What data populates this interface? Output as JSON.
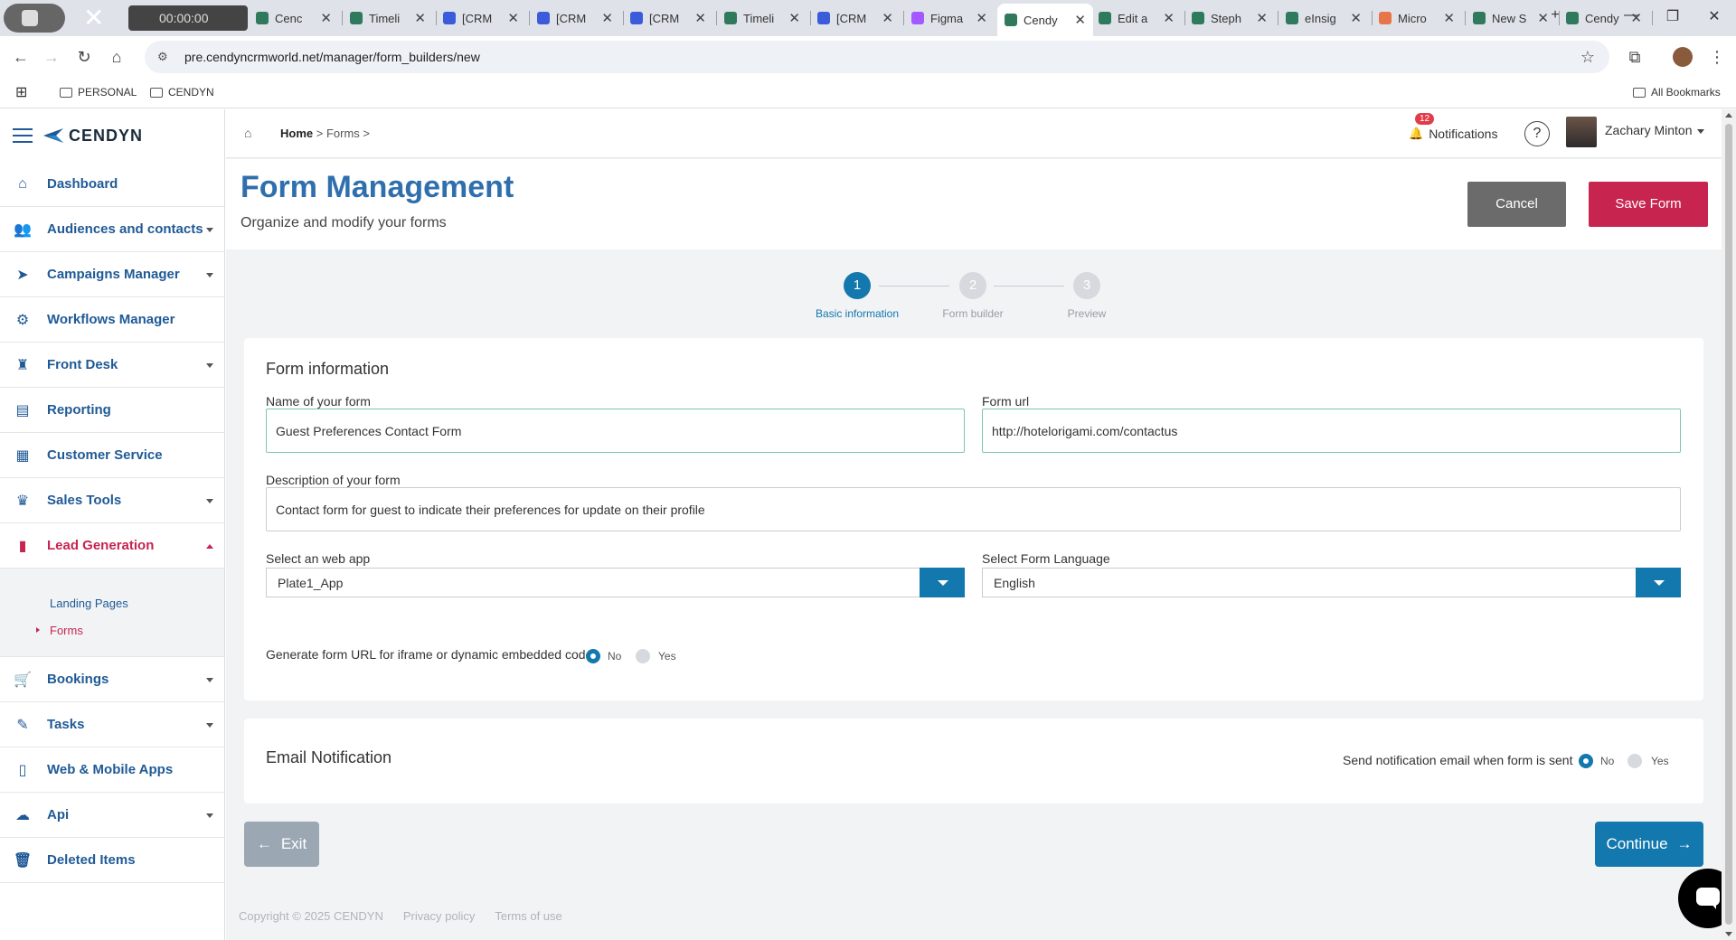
{
  "browser": {
    "tabs": [
      {
        "title": "Cenc",
        "icon": "cendyn-icon",
        "color": "#2f7a5c"
      },
      {
        "title": "Timeli",
        "icon": "cendyn-icon",
        "color": "#2f7a5c"
      },
      {
        "title": "[CRM",
        "icon": "jira-icon",
        "color": "#3b5bdb"
      },
      {
        "title": "[CRM",
        "icon": "jira-icon",
        "color": "#3b5bdb"
      },
      {
        "title": "[CRM",
        "icon": "jira-icon",
        "color": "#3b5bdb"
      },
      {
        "title": "Timeli",
        "icon": "cendyn-icon",
        "color": "#2f7a5c"
      },
      {
        "title": "[CRM",
        "icon": "jira-icon",
        "color": "#3b5bdb"
      },
      {
        "title": "Figma",
        "icon": "figma-icon",
        "color": "#a259ff"
      },
      {
        "title": "Cendy",
        "icon": "cendyn-icon",
        "color": "#2f7a5c"
      },
      {
        "title": "Edit a",
        "icon": "cendyn-icon",
        "color": "#2f7a5c"
      },
      {
        "title": "Steph",
        "icon": "cendyn-icon",
        "color": "#2f7a5c"
      },
      {
        "title": "eInsig",
        "icon": "cendyn-icon",
        "color": "#2f7a5c"
      },
      {
        "title": "Micro",
        "icon": "copilot-icon",
        "color": "#e8744a"
      },
      {
        "title": "New S",
        "icon": "cendyn-icon",
        "color": "#2f7a5c"
      },
      {
        "title": "Cendy",
        "icon": "cendyn-icon",
        "color": "#2f7a5c"
      }
    ],
    "recorder_time": "00:00:00",
    "url": "pre.cendyncrmworld.net/manager/form_builders/new",
    "bookmarks": [
      "PERSONAL",
      "CENDYN"
    ],
    "all_bookmarks": "All Bookmarks"
  },
  "app": {
    "brand": "CENDYN",
    "nav": [
      {
        "label": "Dashboard",
        "icon": "home-icon",
        "caret": false
      },
      {
        "label": "Audiences and contacts",
        "icon": "people-icon",
        "caret": true
      },
      {
        "label": "Campaigns Manager",
        "icon": "paper-plane-icon",
        "caret": true
      },
      {
        "label": "Workflows Manager",
        "icon": "workflow-icon",
        "caret": false
      },
      {
        "label": "Front Desk",
        "icon": "bellhop-icon",
        "caret": true
      },
      {
        "label": "Reporting",
        "icon": "report-icon",
        "caret": false
      },
      {
        "label": "Customer Service",
        "icon": "chat-icon",
        "caret": false
      },
      {
        "label": "Sales Tools",
        "icon": "trophy-icon",
        "caret": true
      },
      {
        "label": "Lead Generation",
        "icon": "bar-chart-icon",
        "caret": true,
        "active": true
      }
    ],
    "lead_generation_sub": [
      "Landing Pages",
      "Forms"
    ],
    "nav_bottom": [
      {
        "label": "Bookings",
        "icon": "cart-icon",
        "caret": true
      },
      {
        "label": "Tasks",
        "icon": "pencil-icon",
        "caret": true
      },
      {
        "label": "Web & Mobile Apps",
        "icon": "mobile-icon",
        "caret": false
      },
      {
        "label": "Api",
        "icon": "cloud-icon",
        "caret": true
      },
      {
        "label": "Deleted Items",
        "icon": "trash-icon",
        "caret": false
      }
    ],
    "breadcrumb": {
      "home": "Home",
      "sep1": " > ",
      "forms": "Forms",
      "sep2": " >"
    },
    "notifications": {
      "label": "Notifications",
      "count": "12"
    },
    "help": "?",
    "user": "Zachary Minton",
    "page": {
      "title": "Form Management",
      "subtitle": "Organize and modify your forms"
    },
    "buttons": {
      "cancel": "Cancel",
      "save": "Save Form",
      "exit": "Exit",
      "continue": "Continue"
    },
    "steps": [
      {
        "num": "1",
        "label": "Basic information",
        "done": true
      },
      {
        "num": "2",
        "label": "Form builder",
        "done": false
      },
      {
        "num": "3",
        "label": "Preview",
        "done": false
      }
    ],
    "form_info": {
      "title": "Form information",
      "name_label": "Name of your form",
      "name_value": "Guest Preferences Contact Form",
      "url_label": "Form url",
      "url_value": "http://hotelorigami.com/contactus",
      "desc_label": "Description of your form",
      "desc_value": "Contact form for guest to indicate their preferences for update on their profile",
      "webapp_label": "Select an web app",
      "webapp_value": "Plate1_App",
      "lang_label": "Select Form Language",
      "lang_value": "English",
      "embed_label": "Generate form URL for iframe or dynamic embedded code",
      "embed_no": "No",
      "embed_yes": "Yes",
      "embed_selected": "No"
    },
    "email_notification": {
      "title": "Email Notification",
      "label": "Send notification email when form is sent",
      "no": "No",
      "yes": "Yes",
      "selected": "No"
    },
    "footer": {
      "copyright": "Copyright © 2025 CENDYN",
      "privacy": "Privacy policy",
      "terms": "Terms of use"
    },
    "colors": {
      "primary": "#1378ad",
      "accent": "#c7244f",
      "title": "#2f6fae"
    }
  }
}
